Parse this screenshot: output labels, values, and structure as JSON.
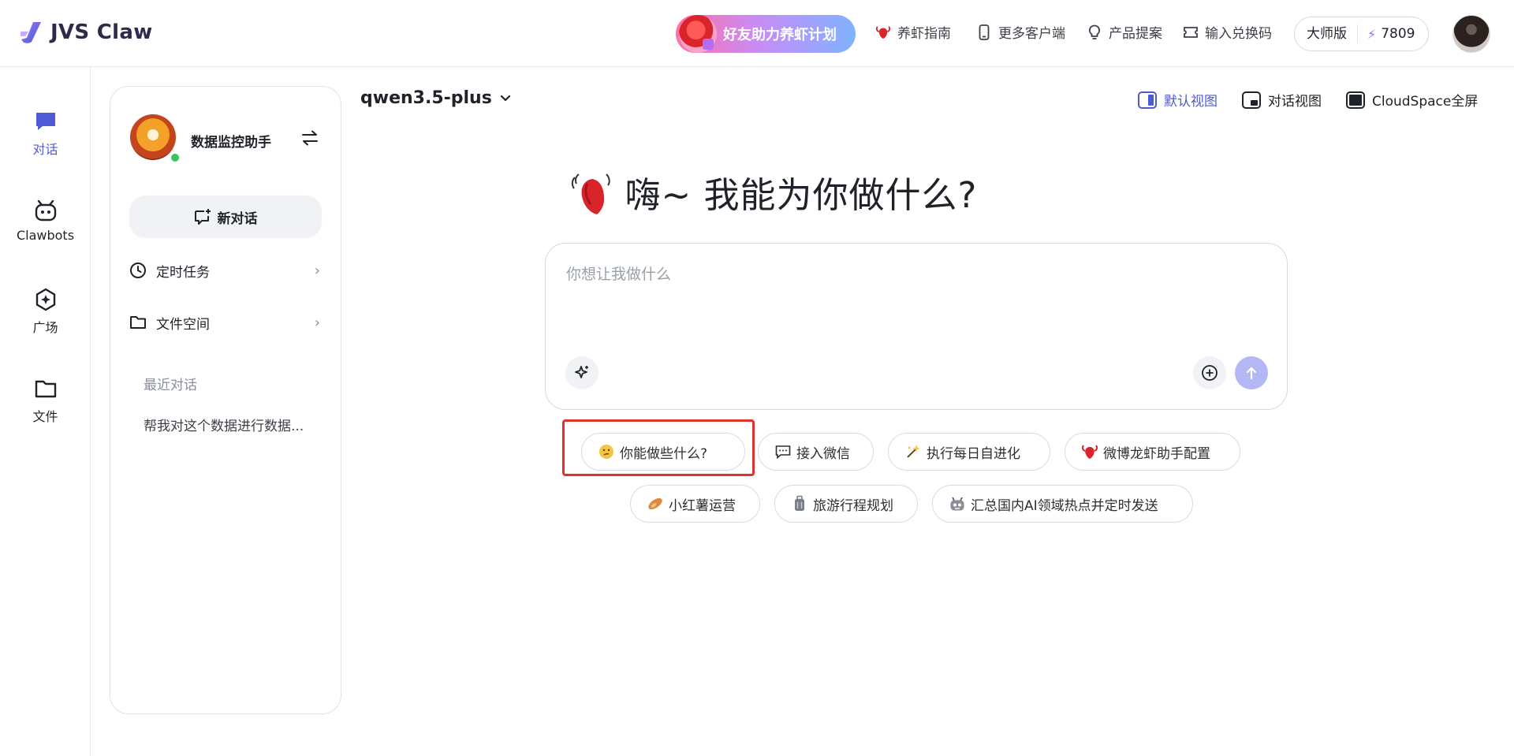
{
  "header": {
    "app_name": "JVS Claw",
    "promo_label": "好友助力养虾计划",
    "nav": [
      {
        "label": "养虾指南",
        "icon": "lobster-icon"
      },
      {
        "label": "更多客户端",
        "icon": "phone-icon"
      },
      {
        "label": "产品提案",
        "icon": "lightbulb-icon"
      },
      {
        "label": "输入兑换码",
        "icon": "ticket-icon"
      }
    ],
    "plan": {
      "name": "大师版",
      "points": "7809",
      "accent": "#8d6ef5"
    }
  },
  "rail": {
    "items": [
      {
        "label": "对话",
        "icon": "chat-icon",
        "active": true
      },
      {
        "label": "Clawbots",
        "icon": "robot-icon"
      },
      {
        "label": "广场",
        "icon": "plaza-icon"
      },
      {
        "label": "文件",
        "icon": "folder-icon"
      }
    ],
    "accent": "#4f5bd5"
  },
  "panel": {
    "bot_name": "数据监控助手",
    "new_chat_label": "新对话",
    "menu": [
      {
        "label": "定时任务",
        "icon": "clock-icon"
      },
      {
        "label": "文件空间",
        "icon": "folder-icon"
      }
    ],
    "recent_title": "最近对话",
    "recent_items": [
      "帮我对这个数据进行数据..."
    ]
  },
  "main": {
    "model": "qwen3.5-plus",
    "views": [
      {
        "label": "默认视图",
        "active": true
      },
      {
        "label": "对话视图"
      },
      {
        "label": "CloudSpace全屏"
      }
    ],
    "greeting": "嗨~ 我能为你做什么?",
    "composer_placeholder": "你想让我做什么",
    "chips": [
      {
        "label": "你能做些什么?",
        "icon": "thinking-face-icon"
      },
      {
        "label": "接入微信",
        "icon": "message-icon"
      },
      {
        "label": "执行每日自进化",
        "icon": "sparkle-icon"
      },
      {
        "label": "微博龙虾助手配置",
        "icon": "lobster-icon"
      },
      {
        "label": "小红薯运营",
        "icon": "sweet-potato-icon"
      },
      {
        "label": "旅游行程规划",
        "icon": "luggage-icon"
      },
      {
        "label": "汇总国内AI领域热点并定时发送",
        "icon": "robot-face-icon"
      }
    ],
    "send_color": "#b3b8f5",
    "highlight_color": "#e0312b"
  }
}
